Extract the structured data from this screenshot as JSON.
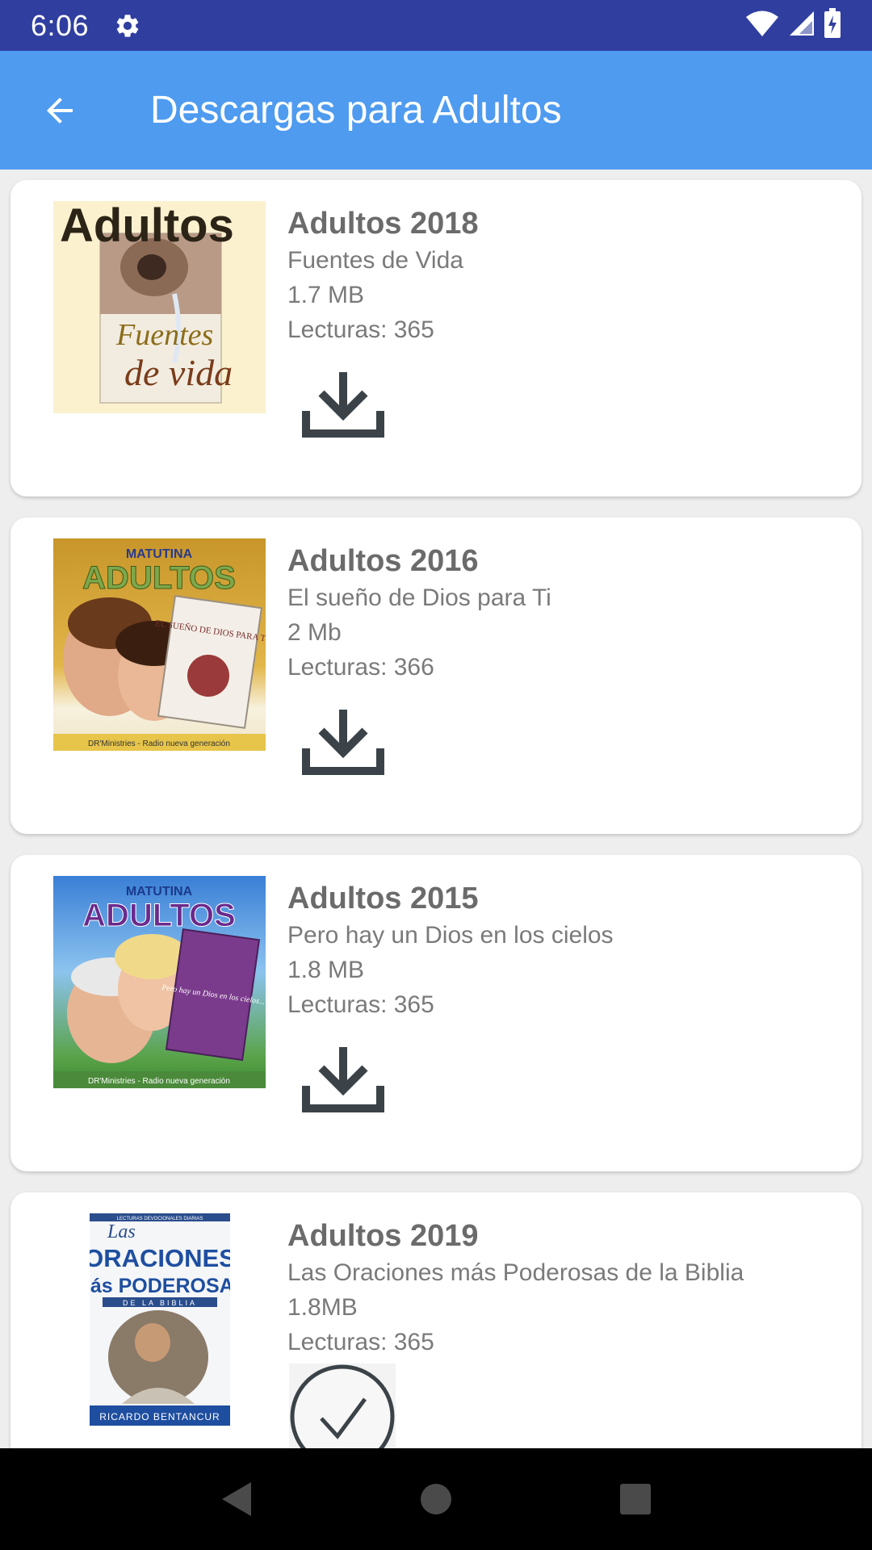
{
  "status_bar": {
    "time": "6:06",
    "icons": [
      "gear-icon",
      "wifi-icon",
      "signal-icon",
      "battery-icon"
    ]
  },
  "app_bar": {
    "back_icon": "arrow-left-icon",
    "title": "Descargas para Adultos",
    "color": "#4e9bf0"
  },
  "items": [
    {
      "title": "Adultos  2018",
      "subtitle": "Fuentes de Vida",
      "size": "1.7 MB",
      "readings": "Lecturas: 365",
      "cover_heading": "Adultos",
      "cover_text_1": "Fuentes",
      "cover_text_2": "de vida",
      "action_icon": "download-icon"
    },
    {
      "title": "Adultos  2016",
      "subtitle": "El sueño de Dios para Ti",
      "size": "2 Mb",
      "readings": "Lecturas: 366",
      "cover_top": "MATUTINA",
      "cover_heading": "ADULTOS",
      "cover_book": "EL SUEÑO DE DIOS PARA TI",
      "cover_footer": "DR'Ministries - Radio nueva generación",
      "action_icon": "download-icon"
    },
    {
      "title": "Adultos  2015",
      "subtitle": "Pero hay un Dios en los cielos",
      "size": "1.8 MB",
      "readings": "Lecturas: 365",
      "cover_top": "MATUTINA",
      "cover_heading": "ADULTOS",
      "cover_book": "Pero hay un Dios en los cielos...",
      "cover_footer": "DR'Ministries - Radio nueva generación",
      "action_icon": "download-icon"
    },
    {
      "title": "Adultos  2019",
      "subtitle": "Las Oraciones más Poderosas de la Biblia",
      "size": "1.8MB",
      "readings": "Lecturas: 365",
      "cover_top": "LECTURAS DEVOCIONALES DIARIAS",
      "cover_heading_1": "Las",
      "cover_heading_2": "ORACIONES",
      "cover_heading_3": "más PODEROSAS",
      "cover_heading_4": "DE LA BIBLIA",
      "cover_footer": "RICARDO BENTANCUR",
      "action_icon": "check-circle-icon"
    }
  ],
  "nav_bar": {
    "icons": [
      "back-triangle-icon",
      "home-circle-icon",
      "recents-square-icon"
    ]
  }
}
